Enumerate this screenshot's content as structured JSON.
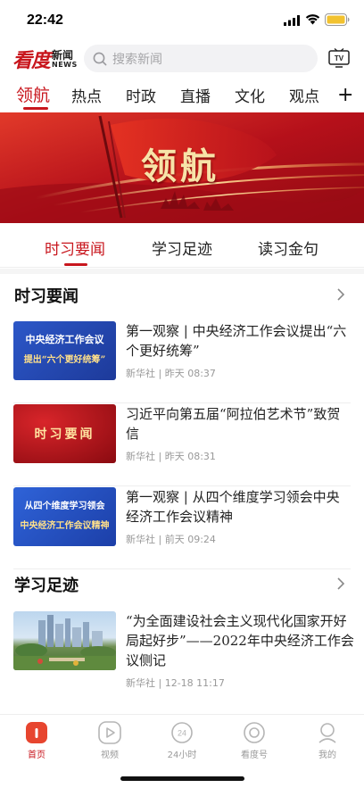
{
  "status_bar": {
    "time": "22:42"
  },
  "header": {
    "logo_main": "看度",
    "logo_sub": "新闻",
    "logo_en": "NEWS",
    "search_placeholder": "搜索新闻",
    "tv_label": "TV"
  },
  "channel_tabs": [
    {
      "label": "领航",
      "active": true
    },
    {
      "label": "热点",
      "active": false
    },
    {
      "label": "时政",
      "active": false
    },
    {
      "label": "直播",
      "active": false
    },
    {
      "label": "文化",
      "active": false
    },
    {
      "label": "观点",
      "active": false
    }
  ],
  "banner": {
    "title": "领航"
  },
  "sub_tabs": [
    {
      "label": "时习要闻",
      "active": true
    },
    {
      "label": "学习足迹",
      "active": false
    },
    {
      "label": "读习金句",
      "active": false
    }
  ],
  "sections": [
    {
      "title": "时习要闻",
      "items": [
        {
          "title": "第一观察 | 中央经济工作会议提出“六个更好统筹”",
          "meta": "新华社 | 昨天 08:37",
          "thumb_lines": [
            "中央经济工作会议",
            "提出“六个更好统筹”"
          ]
        },
        {
          "title": "习近平向第五届“阿拉伯艺术节”致贺信",
          "meta": "新华社 | 昨天 08:31",
          "thumb_lines": [
            "时习要闻"
          ]
        },
        {
          "title": "第一观察 | 从四个维度学习领会中央经济工作会议精神",
          "meta": "新华社 | 前天 09:24",
          "thumb_lines": [
            "从四个维度学习领会",
            "中央经济工作会议精神"
          ]
        }
      ]
    },
    {
      "title": "学习足迹",
      "items": [
        {
          "title": "“为全面建设社会主义现代化国家开好局起好步”——2022年中央经济工作会议侧记",
          "meta": "新华社 | 12-18 11:17"
        }
      ]
    }
  ],
  "bottom_nav": [
    {
      "label": "首页",
      "icon": "home-icon",
      "active": true
    },
    {
      "label": "视频",
      "icon": "video-play-icon",
      "active": false
    },
    {
      "label": "24小时",
      "icon": "clock-24-icon",
      "active": false
    },
    {
      "label": "看度号",
      "icon": "circle-target-icon",
      "active": false
    },
    {
      "label": "我的",
      "icon": "user-icon",
      "active": false
    }
  ],
  "colors": {
    "accent": "#c8161d",
    "tab_blue": "#1f4bb0"
  }
}
